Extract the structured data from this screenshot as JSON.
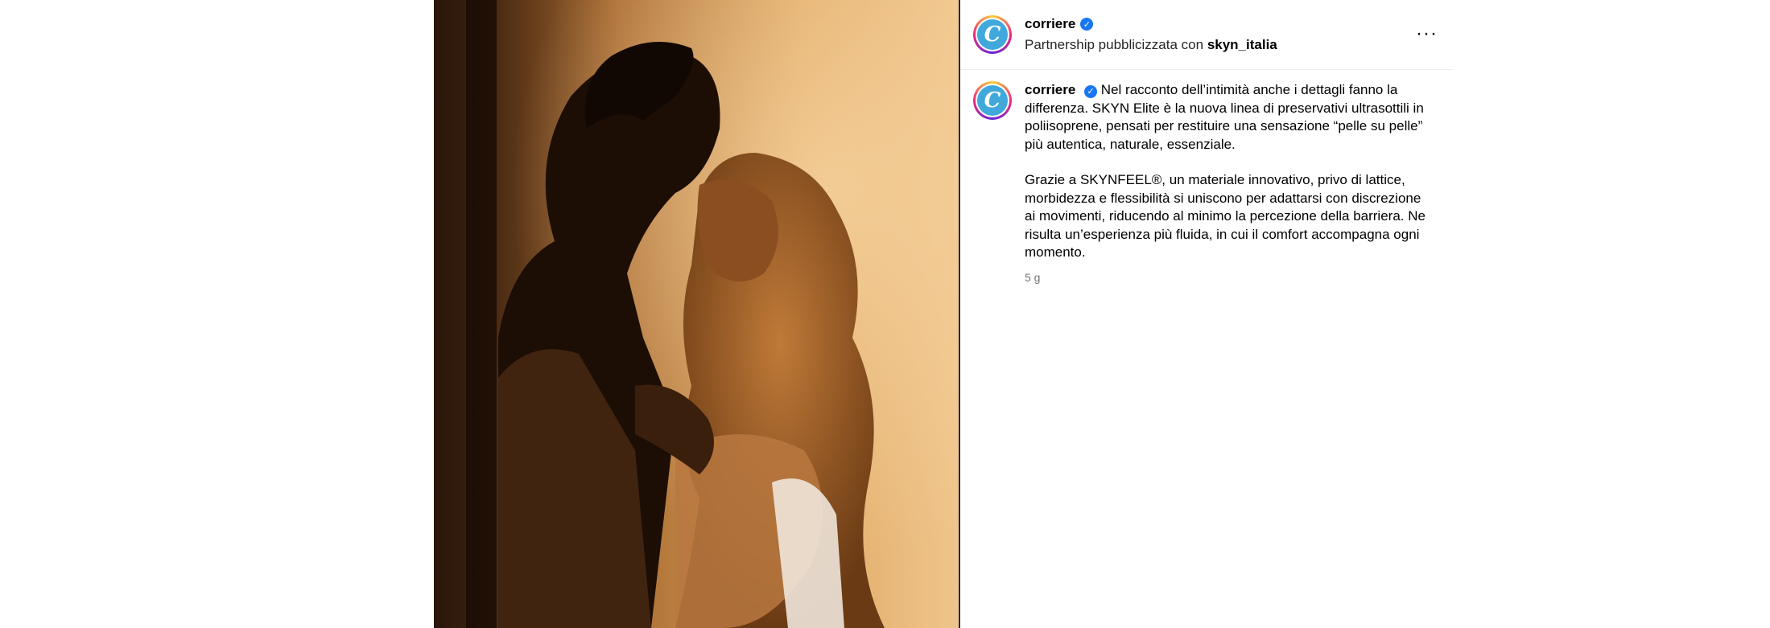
{
  "post": {
    "author": {
      "username": "corriere",
      "avatar_letter": "C",
      "verified": true
    },
    "header": {
      "partnership_prefix": "Partnership pubblicizzata con",
      "partner_handle": "skyn_italia",
      "more_label": "···"
    },
    "caption": {
      "username": "corriere",
      "paragraph_1": "Nel racconto dell’intimità anche i dettagli fanno la differenza. SKYN Elite è la nuova linea di preservativi ultrasottili in poliisoprene, pensati per restituire una sensazione “pelle su pelle” più autentica, naturale, essenziale.",
      "paragraph_2": "Grazie a SKYNFEEL®, un materiale innovativo, privo di lattice, morbidezza e flessibilità si uniscono per adattarsi con discrezione ai movimenti, riducendo al minimo la percezione della barriera. Ne risulta un’esperienza più fluida, in cui il comfort accompagna ogni momento.",
      "timestamp": "5 g"
    },
    "colors": {
      "avatar_fill": "#41a8db",
      "verified_badge": "#1877f2",
      "media_warm": "#e8b06a",
      "media_dark": "#2a160a"
    }
  }
}
